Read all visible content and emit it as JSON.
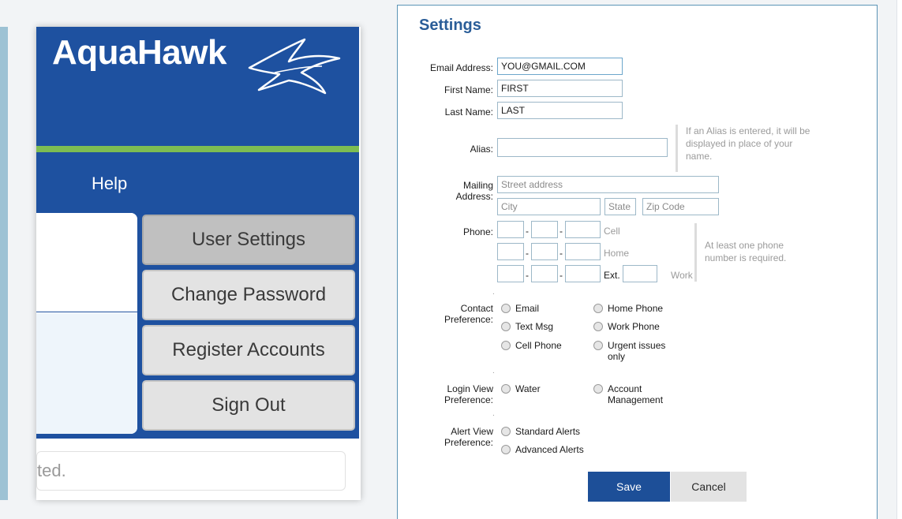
{
  "app": {
    "logo_text": "AquaHawk",
    "help_label": "Help",
    "menu": [
      {
        "label": "User Settings"
      },
      {
        "label": "Change Password"
      },
      {
        "label": "Register Accounts"
      },
      {
        "label": "Sign Out"
      }
    ],
    "status_text": "ted."
  },
  "settings": {
    "title": "Settings",
    "email_label": "Email Address:",
    "email_value": "YOU@GMAIL.COM",
    "first_name_label": "First Name:",
    "first_name_value": "FIRST",
    "last_name_label": "Last Name:",
    "last_name_value": "LAST",
    "alias_label": "Alias:",
    "alias_value": "",
    "alias_hint": "If an Alias is entered, it will be displayed in place of your name.",
    "mailing_label_1": "Mailing",
    "mailing_label_2": "Address:",
    "street_placeholder": "Street address",
    "city_placeholder": "City",
    "state_placeholder": "State",
    "zip_placeholder": "Zip Code",
    "phone_label": "Phone:",
    "phone_tags": {
      "cell": "Cell",
      "home": "Home",
      "work": "Work"
    },
    "ext_label": "Ext.",
    "phone_hint": "At least one phone number is required.",
    "dash": "-",
    "separator": ".",
    "contact_label_1": "Contact",
    "contact_label_2": "Preference:",
    "contact_options": [
      "Email",
      "Home Phone",
      "Text Msg",
      "Work Phone",
      "Cell Phone",
      "Urgent issues only"
    ],
    "login_label_1": "Login View",
    "login_label_2": "Preference:",
    "login_options": [
      "Water",
      "Account Management"
    ],
    "alert_label_1": "Alert View",
    "alert_label_2": "Preference:",
    "alert_options": [
      "Standard Alerts",
      "Advanced Alerts"
    ],
    "save_label": "Save",
    "cancel_label": "Cancel"
  },
  "colors": {
    "brand_blue": "#1e51a0",
    "accent_green": "#7dbd52",
    "title_blue": "#2a5d98"
  }
}
